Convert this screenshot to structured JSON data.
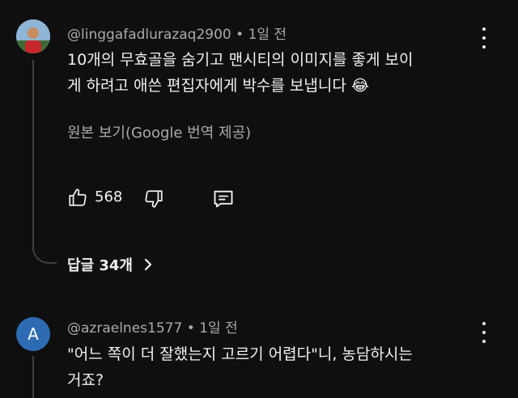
{
  "comments": [
    {
      "handle": "@linggafadlurazaq2900",
      "time": "1일 전",
      "text_line1": "10개의 무효골을 숨기고 맨시티의 이미지를 좋게 보이",
      "text_line2": "게 하려고 애쓴 편집자에게 박수를 보냅니다",
      "emoji": "😂",
      "translate_label": "원본 보기(Google 번역 제공)",
      "likes": "568",
      "replies_label": "답글 34개",
      "icons": [
        "thumbs-up-icon",
        "thumbs-down-icon",
        "reply-icon",
        "more-icon",
        "chevron-right-icon"
      ]
    },
    {
      "avatar_letter": "A",
      "handle": "@azraelnes1577",
      "time": "1일 전",
      "text_line1": "\"어느 쪽이 더 잘했는지 고르기 어렵다\"니, 농담하시는",
      "text_line2": "거죠?",
      "avatar_color": "#2d6bb3"
    }
  ],
  "colors": {
    "background": "#0f0f0f",
    "text": "#f1f1f1",
    "muted": "#aaaaaa"
  }
}
